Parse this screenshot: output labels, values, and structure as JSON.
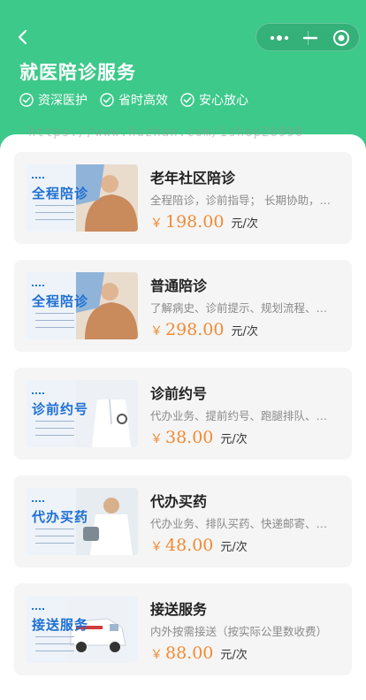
{
  "header": {
    "title": "就医陪诊服务",
    "tags": [
      "资深医护",
      "省时高效",
      "安心放心"
    ],
    "bg_color": "#3cc98a"
  },
  "watermark": "https://www.huzhan.com/ishop26990",
  "icons": {
    "back": "back-arrow-icon",
    "more": "more-dots-icon",
    "minimize": "minimize-icon",
    "close": "close-circle-icon",
    "check": "check-circle-icon"
  },
  "accent": {
    "price": "#f28a33",
    "thumb_title": "#1e6fd2"
  },
  "services": [
    {
      "thumb": "全程陪诊",
      "name": "老年社区陪诊",
      "desc": "全程陪诊，诊前指导； 长期协助，…",
      "currency": "￥",
      "price": "198.00",
      "unit": "元/次"
    },
    {
      "thumb": "全程陪诊",
      "name": "普通陪诊",
      "desc": "了解病史、诊前提示、规划流程、…",
      "currency": "￥",
      "price": "298.00",
      "unit": "元/次"
    },
    {
      "thumb": "诊前约号",
      "name": "诊前约号",
      "desc": "代办业务、提前约号、跑腿排队、…",
      "currency": "￥",
      "price": "38.00",
      "unit": "元/次"
    },
    {
      "thumb": "代办买药",
      "name": "代办买药",
      "desc": "代办业务、排队买药、快递邮寄、…",
      "currency": "￥",
      "price": "48.00",
      "unit": "元/次"
    },
    {
      "thumb": "接送服务",
      "name": "接送服务",
      "desc": "内外按需接送（按实际公里数收费）",
      "currency": "￥",
      "price": "88.00",
      "unit": "元/次"
    }
  ]
}
